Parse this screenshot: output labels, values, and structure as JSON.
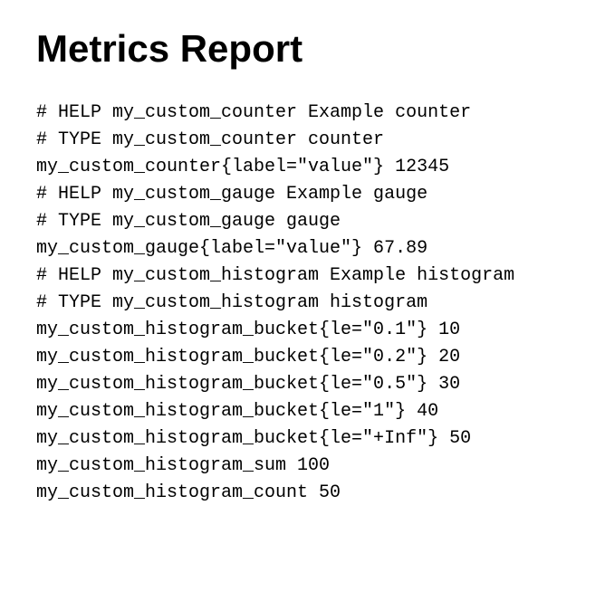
{
  "title": "Metrics Report",
  "metrics_text": "# HELP my_custom_counter Example counter\n# TYPE my_custom_counter counter\nmy_custom_counter{label=\"value\"} 12345\n# HELP my_custom_gauge Example gauge\n# TYPE my_custom_gauge gauge\nmy_custom_gauge{label=\"value\"} 67.89\n# HELP my_custom_histogram Example histogram\n# TYPE my_custom_histogram histogram\nmy_custom_histogram_bucket{le=\"0.1\"} 10\nmy_custom_histogram_bucket{le=\"0.2\"} 20\nmy_custom_histogram_bucket{le=\"0.5\"} 30\nmy_custom_histogram_bucket{le=\"1\"} 40\nmy_custom_histogram_bucket{le=\"+Inf\"} 50\nmy_custom_histogram_sum 100\nmy_custom_histogram_count 50"
}
